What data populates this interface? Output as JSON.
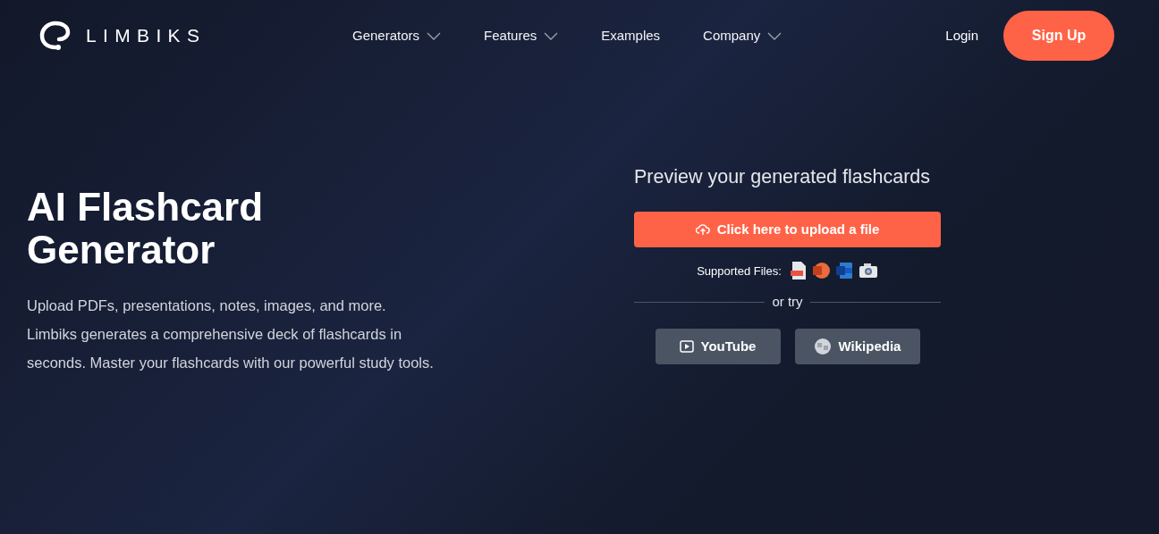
{
  "header": {
    "logo": "LIMBIKS",
    "nav": [
      {
        "label": "Generators",
        "dropdown": true
      },
      {
        "label": "Features",
        "dropdown": true
      },
      {
        "label": "Examples",
        "dropdown": false
      },
      {
        "label": "Company",
        "dropdown": true
      }
    ],
    "login": "Login",
    "signup": "Sign Up"
  },
  "hero": {
    "title": "AI Flashcard Generator",
    "description": "Upload PDFs, presentations, notes, images, and more. Limbiks generates a comprehensive deck of flashcards in seconds. Master your flashcards with our powerful study tools."
  },
  "upload": {
    "heading": "Preview your generated flashcards",
    "button": "Click here to upload a file",
    "supported_label": "Supported Files:",
    "file_types": [
      {
        "kind": "pdf"
      },
      {
        "kind": "powerpoint"
      },
      {
        "kind": "word"
      },
      {
        "kind": "image"
      }
    ],
    "divider": "or try",
    "sources": [
      {
        "kind": "youtube",
        "label": "YouTube"
      },
      {
        "kind": "wikipedia",
        "label": "Wikipedia"
      }
    ]
  }
}
